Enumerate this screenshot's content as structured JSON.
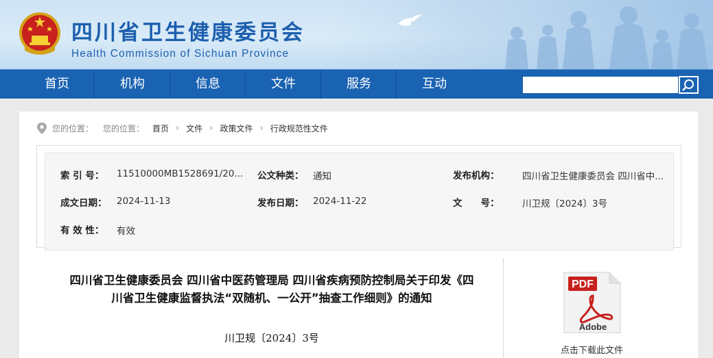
{
  "header": {
    "title": "四川省卫生健康委员会",
    "subtitle": "Health Commission of Sichuan Province"
  },
  "nav": {
    "items": [
      {
        "label": "首页"
      },
      {
        "label": "机构"
      },
      {
        "label": "信息"
      },
      {
        "label": "文件"
      },
      {
        "label": "服务"
      },
      {
        "label": "互动"
      }
    ],
    "search_placeholder": ""
  },
  "breadcrumb": {
    "prefix1": "您的位置：",
    "prefix2": "您的位置：",
    "items": [
      "首页",
      "文件",
      "政策文件",
      "行政规范性文件"
    ],
    "separator": "›"
  },
  "meta": {
    "index_label": "索 引 号：",
    "index_value": "11510000MB1528691/20...",
    "doc_type_label": "公文种类：",
    "doc_type_value": "通知",
    "publisher_label": "发布机构：",
    "publisher_value": "四川省卫生健康委员会 四川省中...",
    "created_label": "成文日期：",
    "created_value": "2024-11-13",
    "published_label": "发布日期：",
    "published_value": "2024-11-22",
    "number_label": "文　　号：",
    "number_value": "川卫规〔2024〕3号",
    "validity_label": "有 效 性：",
    "validity_value": "有效"
  },
  "document": {
    "title_line1": "四川省卫生健康委员会 四川省中医药管理局 四川省疾病预防控制局关于印发《四",
    "title_line2": "川省卫生健康监督执法“双随机、一公开”抽查工作细则》的通知",
    "number": "川卫规〔2024〕3号"
  },
  "download": {
    "pdf_label": "PDF",
    "adobe_label": "Adobe",
    "caption": "点击下载此文件"
  },
  "colors": {
    "nav_blue": "#1a63b2",
    "title_blue": "#1d5fae",
    "pdf_red": "#c8201d"
  }
}
